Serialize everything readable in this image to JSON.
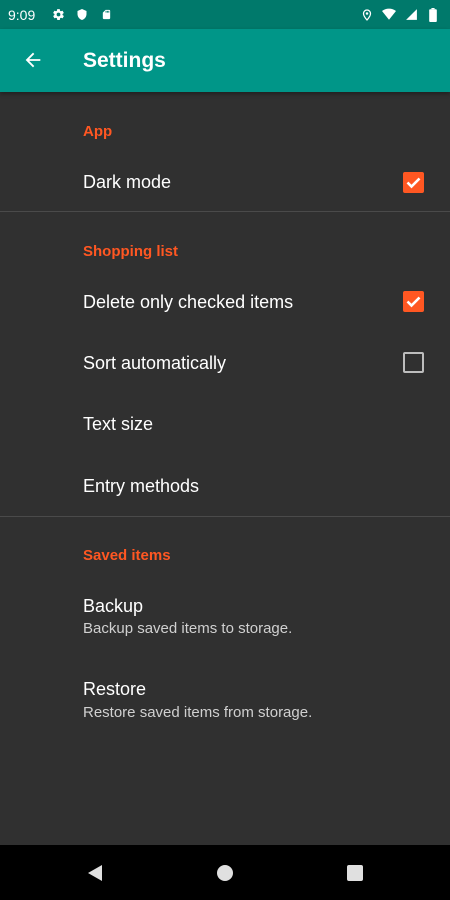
{
  "status_bar": {
    "time": "9:09",
    "icons": [
      "settings-icon",
      "shield-icon",
      "sd-card-icon",
      "location-icon",
      "wifi-icon",
      "signal-icon",
      "battery-icon"
    ]
  },
  "app_bar": {
    "title": "Settings",
    "back_icon": "arrow-left-icon",
    "background": "#009688"
  },
  "sections": [
    {
      "header": "App",
      "items": [
        {
          "title": "Dark mode",
          "control": "checkbox",
          "checked": true
        }
      ]
    },
    {
      "header": "Shopping list",
      "items": [
        {
          "title": "Delete only checked items",
          "control": "checkbox",
          "checked": true
        },
        {
          "title": "Sort automatically",
          "control": "checkbox",
          "checked": false
        },
        {
          "title": "Text size"
        },
        {
          "title": "Entry methods"
        }
      ]
    },
    {
      "header": "Saved items",
      "items": [
        {
          "title": "Backup",
          "summary": "Backup saved items to storage."
        },
        {
          "title": "Restore",
          "summary": "Restore saved items from storage."
        }
      ]
    }
  ],
  "nav_bar": {
    "icons": [
      "back-triangle-icon",
      "home-circle-icon",
      "recents-square-icon"
    ]
  },
  "colors": {
    "accent": "#FF5722",
    "status_bar": "#00796B",
    "background": "#303030"
  }
}
